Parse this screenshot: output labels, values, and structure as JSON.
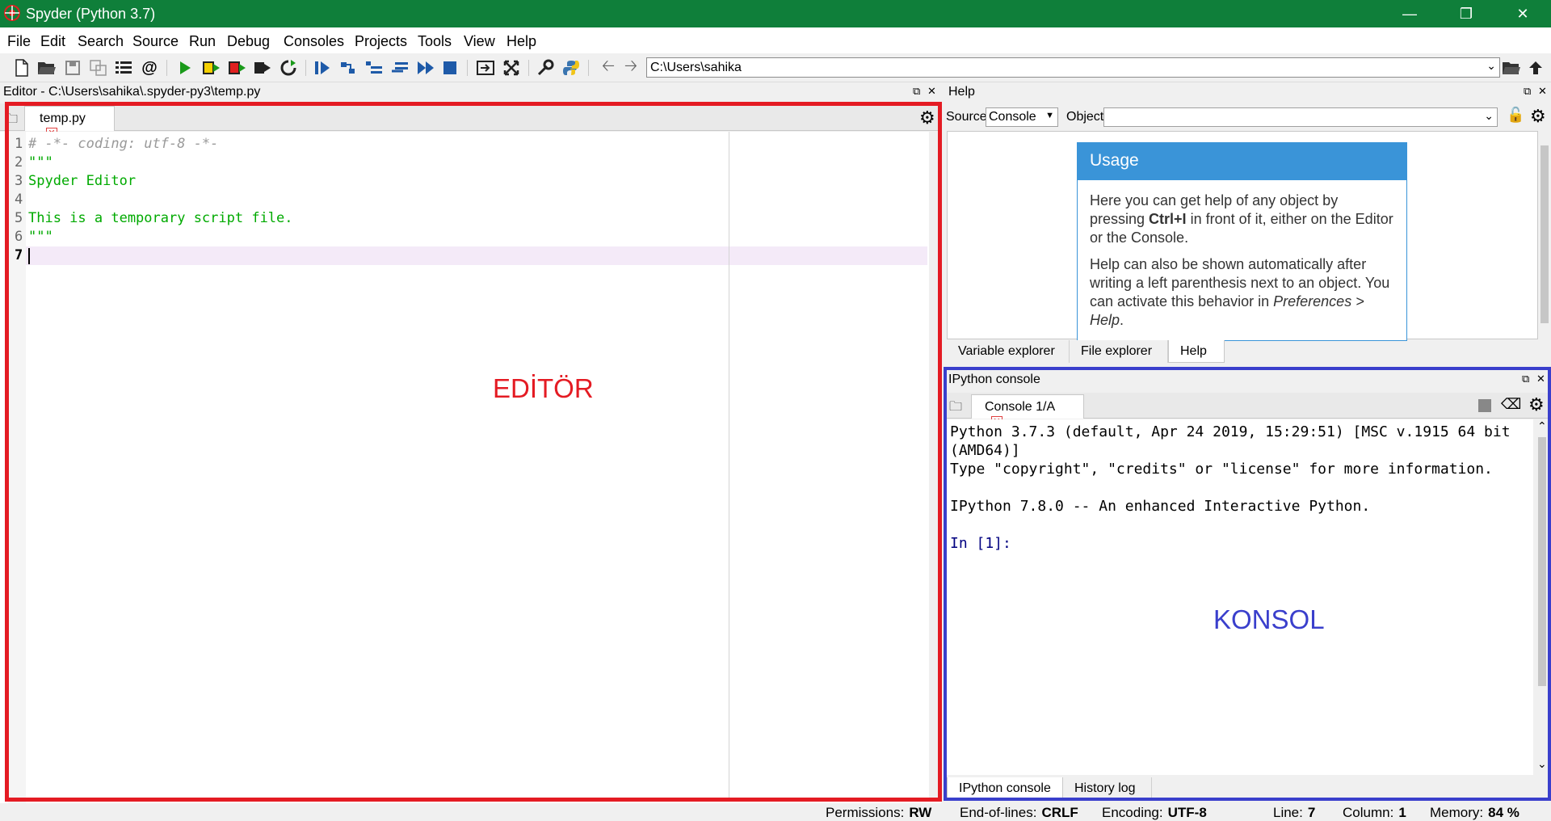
{
  "window": {
    "title": "Spyder (Python 3.7)"
  },
  "menu": [
    "File",
    "Edit",
    "Search",
    "Source",
    "Run",
    "Debug",
    "Consoles",
    "Projects",
    "Tools",
    "View",
    "Help"
  ],
  "toolbar": {
    "path": "C:\\Users\\sahika"
  },
  "editor": {
    "pane_title": "Editor - C:\\Users\\sahika\\.spyder-py3\\temp.py",
    "tab_label": "temp.py",
    "line_numbers": [
      "1",
      "2",
      "3",
      "4",
      "5",
      "6",
      "7"
    ],
    "lines": [
      "# -*- coding: utf-8 -*-",
      "\"\"\"",
      "Spyder Editor",
      "",
      "This is a temporary script file.",
      "\"\"\"",
      ""
    ],
    "overlay_label": "EDİTÖR"
  },
  "help": {
    "pane_title": "Help",
    "source_label": "Source",
    "source_value": "Console",
    "object_label": "Object",
    "object_value": "",
    "usage_title": "Usage",
    "usage_p1_a": "Here you can get help of any object by pressing ",
    "usage_p1_bold": "Ctrl+I",
    "usage_p1_b": " in front of it, either on the Editor or the Console.",
    "usage_p2_a": "Help can also be shown automatically after writing a left parenthesis next to an object. You can activate this behavior in ",
    "usage_p2_italic": "Preferences > Help",
    "usage_p2_b": ".",
    "tabs": [
      "Variable explorer",
      "File explorer",
      "Help"
    ]
  },
  "console": {
    "pane_title": "IPython console",
    "tab_label": "Console 1/A",
    "lines": [
      "Python 3.7.3 (default, Apr 24 2019, 15:29:51) [MSC v.1915 64 bit",
      "(AMD64)]",
      "Type \"copyright\", \"credits\" or \"license\" for more information.",
      "",
      "IPython 7.8.0 -- An enhanced Interactive Python.",
      "",
      "In [1]:"
    ],
    "overlay_label": "KONSOL",
    "tabs": [
      "IPython console",
      "History log"
    ]
  },
  "status": {
    "permissions_label": "Permissions:",
    "permissions_value": "RW",
    "eol_label": "End-of-lines:",
    "eol_value": "CRLF",
    "encoding_label": "Encoding:",
    "encoding_value": "UTF-8",
    "line_label": "Line:",
    "line_value": "7",
    "column_label": "Column:",
    "column_value": "1",
    "memory_label": "Memory:",
    "memory_value": "84 %"
  },
  "colors": {
    "titlebar": "#0f7f3a",
    "editor_box": "#e41b23",
    "console_box": "#3a3fcc",
    "usage_head": "#3a94d8",
    "comment": "#999999",
    "string": "#00aa00",
    "prompt": "#000080"
  },
  "icons": [
    "new-file-icon",
    "open-folder-icon",
    "save-icon",
    "save-all-icon",
    "list-icon",
    "at-icon",
    "run-icon",
    "run-cell-icon",
    "run-cell-advance-icon",
    "run-selection-icon",
    "rerun-icon",
    "debug-icon",
    "step-icon",
    "step-into-icon",
    "step-return-icon",
    "continue-icon",
    "stop-icon",
    "maximize-pane-icon",
    "fullscreen-icon",
    "preferences-icon",
    "python-path-icon",
    "back-arrow-icon",
    "forward-arrow-icon",
    "browse-folder-icon",
    "parent-dir-icon"
  ]
}
